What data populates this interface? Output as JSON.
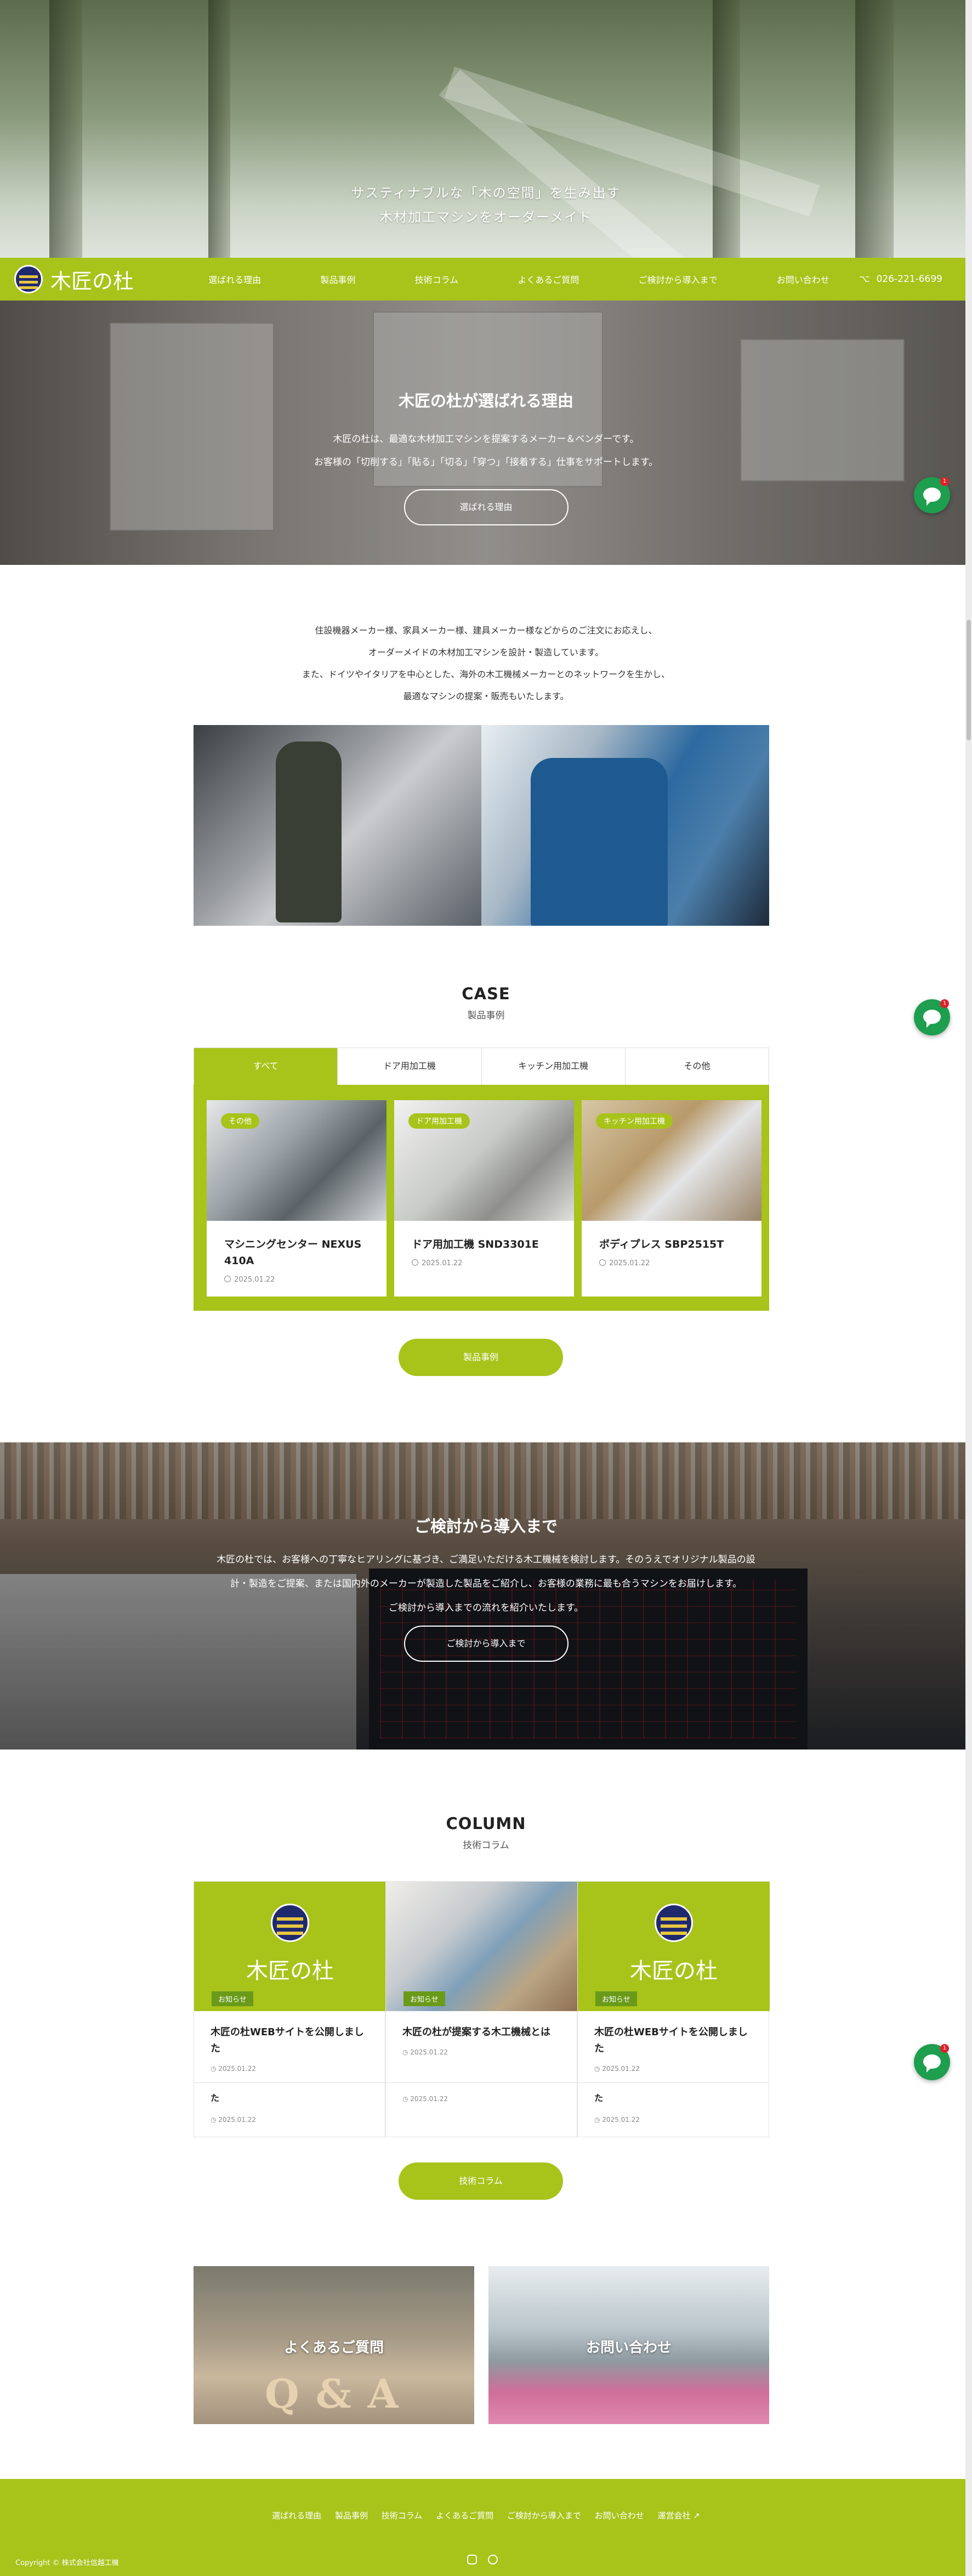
{
  "hero": {
    "line1": "サスティナブルな「木の空間」を生み出す",
    "line2": "木材加工マシンをオーダーメイド"
  },
  "nav": {
    "logo_text": "木匠の杜",
    "items": [
      "選ばれる理由",
      "製品事例",
      "技術コラム",
      "よくあるご質問",
      "ご検討から導入まで",
      "お問い合わせ"
    ],
    "phone": "026-221-6699",
    "phone_icon": "share-icon"
  },
  "reason": {
    "title": "木匠の杜が選ばれる理由",
    "line1": "木匠の杜は、最適な木材加工マシンを提案するメーカー＆ベンダーです。",
    "line2": "お客様の「切削する」「貼る」「切る」「穿つ」「接着する」仕事をサポートします。",
    "button": "選ばれる理由"
  },
  "intro": {
    "line1": "住設機器メーカー様、家具メーカー様、建具メーカー様などからのご注文にお応えし、",
    "line2": "オーダーメイドの木材加工マシンを設計・製造しています。",
    "line3": "また、ドイツやイタリアを中心とした、海外の木工機械メーカーとのネットワークを生かし、",
    "line4": "最適なマシンの提案・販売もいたします。"
  },
  "case": {
    "title_en": "CASE",
    "title_ja": "製品事例",
    "tabs": [
      "すべて",
      "ドア用加工機",
      "キッチン用加工機",
      "その他"
    ],
    "cards": [
      {
        "badge": "その他",
        "title": "マシニングセンター NEXUS 410A",
        "date": "2025.01.22"
      },
      {
        "badge": "ドア用加工機",
        "title": "ドア用加工機 SND3301E",
        "date": "2025.01.22"
      },
      {
        "badge": "キッチン用加工機",
        "title": "ボディプレス SBP2515T",
        "date": "2025.01.22"
      }
    ],
    "button": "製品事例"
  },
  "flow": {
    "title": "ご検討から導入まで",
    "line1": "木匠の杜では、お客様への丁寧なヒアリングに基づき、ご満足いただける木工機械を検討します。そのうえでオリジナル製品の設",
    "line2": "計・製造をご提案、または国内外のメーカーが製造した製品をご紹介し、お客様の業務に最も合うマシンをお届けします。",
    "line3": "ご検討から導入までの流れを紹介いたします。",
    "button": "ご検討から導入まで"
  },
  "column": {
    "title_en": "COLUMN",
    "title_ja": "技術コラム",
    "cards": [
      {
        "brand": "木匠の杜",
        "badge": "お知らせ",
        "title": "木匠の杜WEBサイトを公開しました",
        "date": "2025.01.22",
        "extra": "た",
        "date2": "2025.01.22"
      },
      {
        "brand": "",
        "badge": "お知らせ",
        "title": "木匠の杜が提案する木工機械とは",
        "date": "2025.01.22",
        "extra": "",
        "date2": "2025.01.22"
      },
      {
        "brand": "木匠の杜",
        "badge": "お知らせ",
        "title": "木匠の杜WEBサイトを公開しました",
        "date": "2025.01.22",
        "extra": "た",
        "date2": "2025.01.22"
      }
    ],
    "button": "技術コラム"
  },
  "banners": {
    "faq": "よくあるご質問",
    "faq_letters": "Q&A",
    "contact": "お問い合わせ"
  },
  "footer": {
    "links": [
      "選ばれる理由",
      "製品事例",
      "技術コラム",
      "よくあるご質問",
      "ご検討から導入まで",
      "お問い合わせ",
      "運営会社 ↗"
    ],
    "copyright": "Copyright © 株式会社信越工機"
  },
  "chat": {
    "badge_count": "1"
  },
  "colors": {
    "brand_green": "#a8c31a",
    "navy": "#1f2a6e",
    "chat_green": "#1e9e4f"
  }
}
